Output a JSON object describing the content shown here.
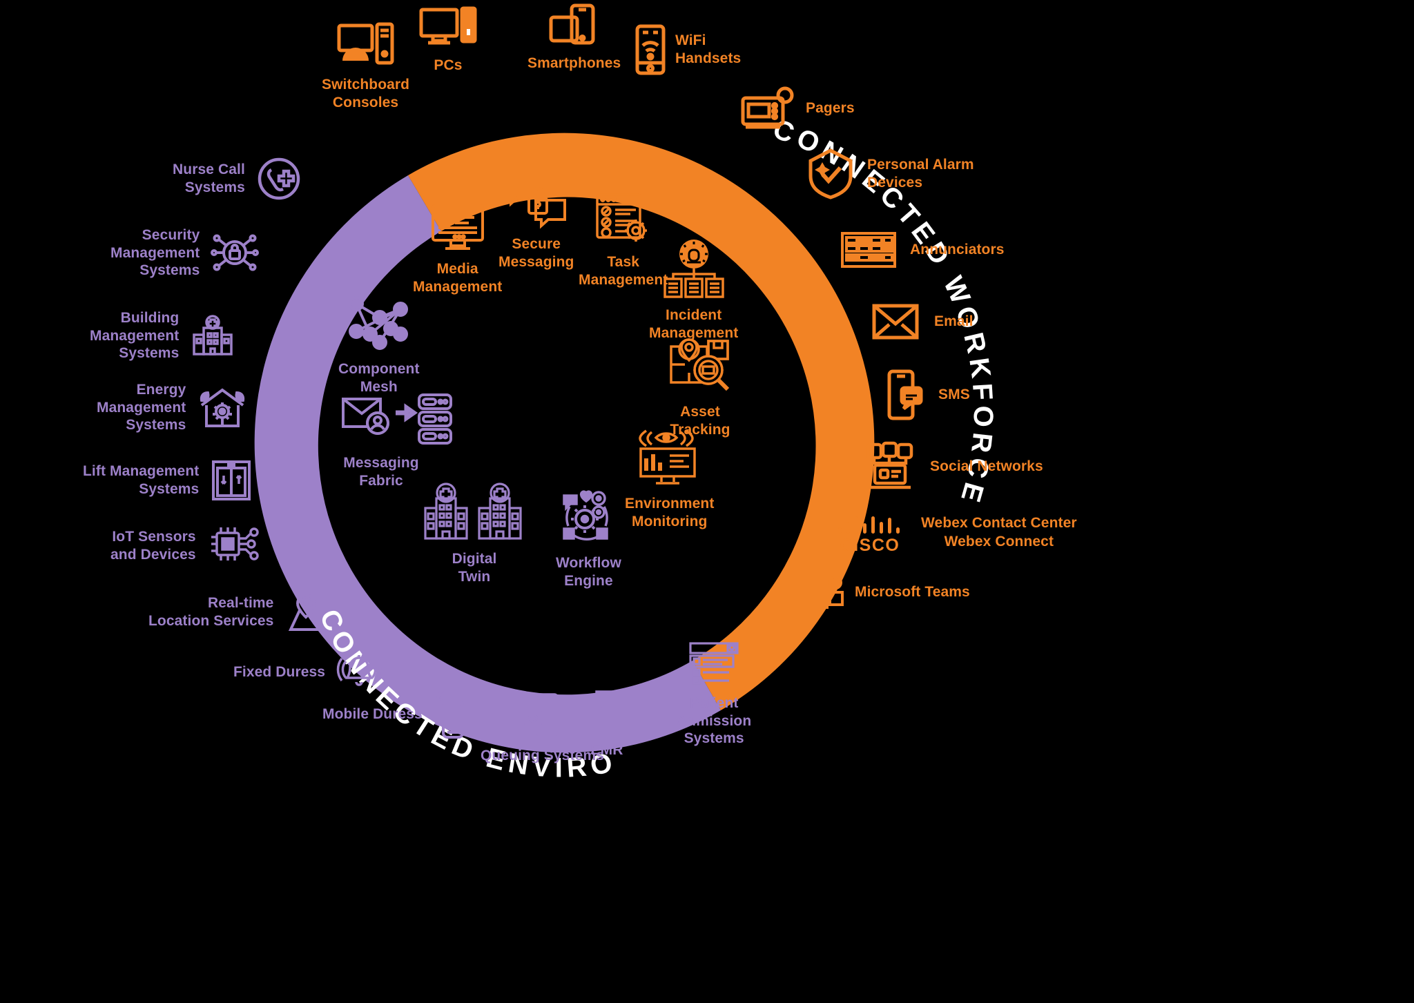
{
  "diagram": {
    "title_hidden": "",
    "colors": {
      "workforce": "#F28325",
      "environment": "#9D81C9",
      "background": "#000000",
      "ring_label": "#FFFFFF"
    },
    "rings": [
      {
        "id": "connected-workforce",
        "label": "CONNECTED WORKFORCE",
        "color": "#F28325"
      },
      {
        "id": "connected-environment",
        "label": "CONNECTED ENVIRONMENT",
        "color": "#9D81C9"
      }
    ],
    "outer_workforce": [
      {
        "label": "Switchboard\nConsoles",
        "icon": "desktop-tower-icon"
      },
      {
        "label": "PCs",
        "icon": "pc-monitor-icon"
      },
      {
        "label": "Smartphones",
        "icon": "smartphones-icon"
      },
      {
        "label": "WiFi\nHandsets",
        "icon": "wifi-handset-icon"
      },
      {
        "label": "Pagers",
        "icon": "pager-icon"
      },
      {
        "label": "Personal Alarm\nDevices",
        "icon": "shield-check-icon"
      },
      {
        "label": "Annunciators",
        "icon": "annunciator-panel-icon"
      },
      {
        "label": "Email",
        "icon": "envelope-icon"
      },
      {
        "label": "SMS",
        "icon": "sms-phone-icon"
      },
      {
        "label": "Social Networks",
        "icon": "social-networks-icon"
      },
      {
        "label": "Webex Contact Center\nWebex Connect",
        "icon": "cisco-logo-icon"
      },
      {
        "label": "Microsoft Teams",
        "icon": "microsoft-teams-icon"
      }
    ],
    "outer_environment": [
      {
        "label": "Nurse Call\nSystems",
        "icon": "nurse-call-icon"
      },
      {
        "label": "Security\nManagement\nSystems",
        "icon": "security-lock-network-icon"
      },
      {
        "label": "Building\nManagement\nSystems",
        "icon": "hospital-building-icon"
      },
      {
        "label": "Energy\nManagement\nSystems",
        "icon": "eco-house-gear-icon"
      },
      {
        "label": "Lift Management\nSystems",
        "icon": "elevator-icon"
      },
      {
        "label": "IoT Sensors\nand Devices",
        "icon": "chip-iot-icon"
      },
      {
        "label": "Real-time\nLocation Services",
        "icon": "map-pin-icon"
      },
      {
        "label": "Fixed Duress",
        "icon": "ringing-bell-icon"
      },
      {
        "label": "Mobile Duress",
        "icon": "mobile-signal-icon"
      },
      {
        "label": "Queuing Systems",
        "icon": "ticket-kiosk-icon"
      },
      {
        "label": "EMR",
        "icon": "medical-folder-icon"
      },
      {
        "label": "Patient\nAdmission\nSystems",
        "icon": "admission-list-icon"
      }
    ],
    "inner_workforce": [
      {
        "label": "Media\nManagement",
        "icon": "media-monitor-icon"
      },
      {
        "label": "Secure\nMessaging",
        "icon": "secure-chat-lock-icon"
      },
      {
        "label": "Task\nManagement",
        "icon": "task-checklist-gear-icon"
      },
      {
        "label": "Incident\nManagement",
        "icon": "incident-siren-icon"
      },
      {
        "label": "Asset\nTracking",
        "icon": "asset-map-magnifier-icon"
      },
      {
        "label": "Environment\nMonitoring",
        "icon": "environment-monitor-icon"
      }
    ],
    "inner_environment": [
      {
        "label": "Component\nMesh",
        "icon": "node-mesh-icon"
      },
      {
        "label": "Messaging\nFabric",
        "icon": "mail-to-server-icon"
      },
      {
        "label": "Digital\nTwin",
        "icon": "twin-hospital-icon"
      },
      {
        "label": "Workflow\nEngine",
        "icon": "workflow-gears-icon"
      }
    ]
  }
}
